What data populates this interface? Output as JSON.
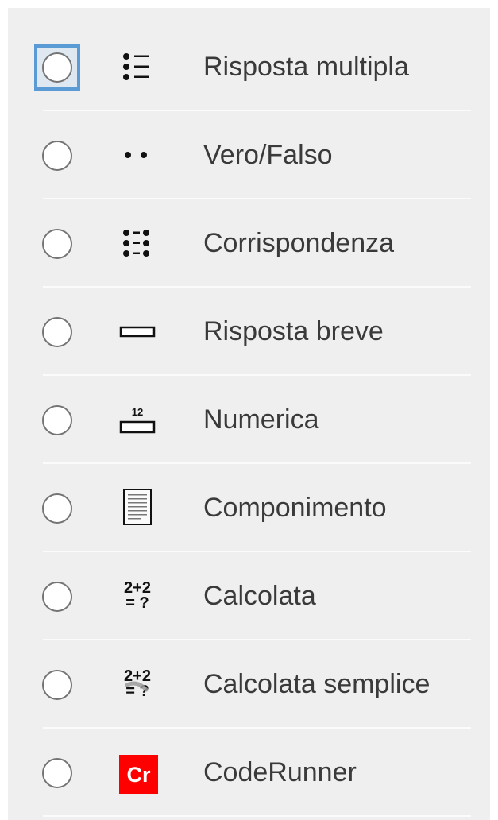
{
  "question_types": [
    {
      "label": "Risposta multipla",
      "icon": "multiple-choice-icon",
      "selected": false
    },
    {
      "label": "Vero/Falso",
      "icon": "true-false-icon",
      "selected": false
    },
    {
      "label": "Corrispondenza",
      "icon": "matching-icon",
      "selected": false
    },
    {
      "label": "Risposta breve",
      "icon": "short-answer-icon",
      "selected": false
    },
    {
      "label": "Numerica",
      "icon": "numerical-icon",
      "icon_text": "12",
      "selected": false
    },
    {
      "label": "Componimento",
      "icon": "essay-icon",
      "selected": false
    },
    {
      "label": "Calcolata",
      "icon": "calculated-icon",
      "icon_text_top": "2+2",
      "icon_text_bottom": "= ?",
      "selected": false
    },
    {
      "label": "Calcolata semplice",
      "icon": "calculated-simple-icon",
      "icon_text_top": "2+2",
      "icon_text_bottom": "= ?",
      "selected": false
    },
    {
      "label": "CodeRunner",
      "icon": "coderunner-icon",
      "icon_text": "Cr",
      "selected": false
    }
  ],
  "colors": {
    "panel_bg": "#efefef",
    "focus_ring": "#5b9bd5",
    "coderunner_red": "#ff0000",
    "label_text": "#3a3a3a"
  }
}
